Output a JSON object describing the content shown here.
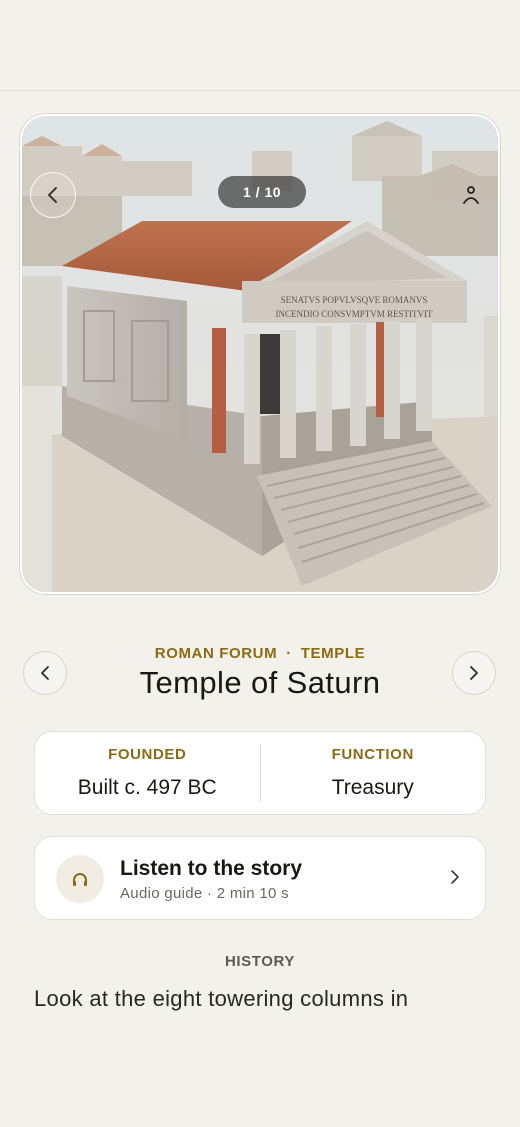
{
  "photo": {
    "counter": "1 / 10",
    "inscription_line1": "SENATVS POPVLVSQVE ROMANVS",
    "inscription_line2": "INCENDIO CONSVMPTVM RESTITVIT"
  },
  "place": {
    "category": "ROMAN FORUM",
    "separator": "·",
    "type": "TEMPLE",
    "title": "Temple of Saturn"
  },
  "facts": [
    {
      "label": "FOUNDED",
      "value": "Built c. 497 BC"
    },
    {
      "label": "FUNCTION",
      "value": "Treasury"
    }
  ],
  "audio": {
    "title": "Listen to the story",
    "subtitle": "Audio guide · 2 min 10 s",
    "icon": "headphones-icon"
  },
  "history": {
    "label": "HISTORY",
    "text": "Look at the eight towering columns in"
  },
  "colors": {
    "background": "#f3f1ec",
    "accent": "#8d6a14",
    "card": "#ffffff"
  }
}
